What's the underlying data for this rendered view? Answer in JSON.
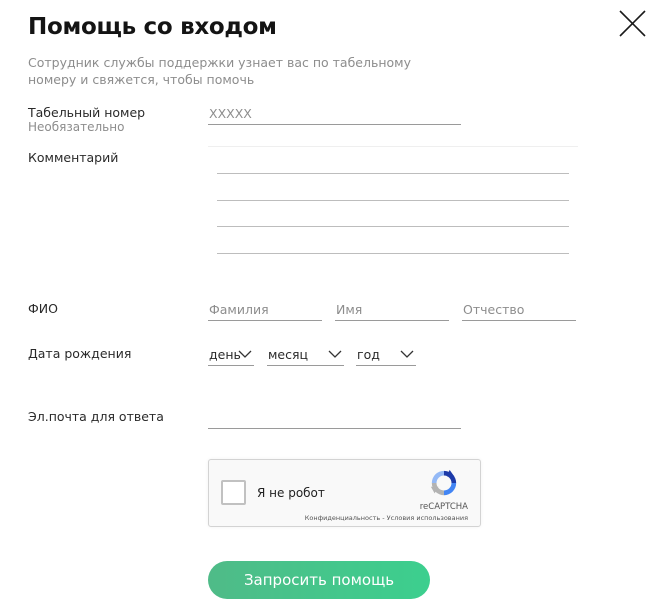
{
  "header": {
    "title": "Помощь со входом",
    "subtitle": "Сотрудник службы поддержки узнает вас по табельному номеру и свяжется, чтобы помочь",
    "close_icon": "close-icon"
  },
  "form": {
    "employee_id": {
      "label": "Табельный номер",
      "hint": "Необязательно",
      "placeholder": "XXXXX"
    },
    "comment": {
      "label": "Комментарий"
    },
    "full_name": {
      "label": "ФИО",
      "last_name_placeholder": "Фамилия",
      "first_name_placeholder": "Имя",
      "middle_name_placeholder": "Отчество"
    },
    "birth_date": {
      "label": "Дата рождения",
      "day": "день",
      "month": "месяц",
      "year": "год"
    },
    "email": {
      "label": "Эл.почта для ответа"
    }
  },
  "captcha": {
    "checkbox_label": "Я не робот",
    "brand": "reCAPTCHA",
    "links": "Конфиденциальность - Условия использования"
  },
  "submit": {
    "label": "Запросить помощь",
    "color_start": "#4fbb88",
    "color_end": "#3ccf8e"
  }
}
